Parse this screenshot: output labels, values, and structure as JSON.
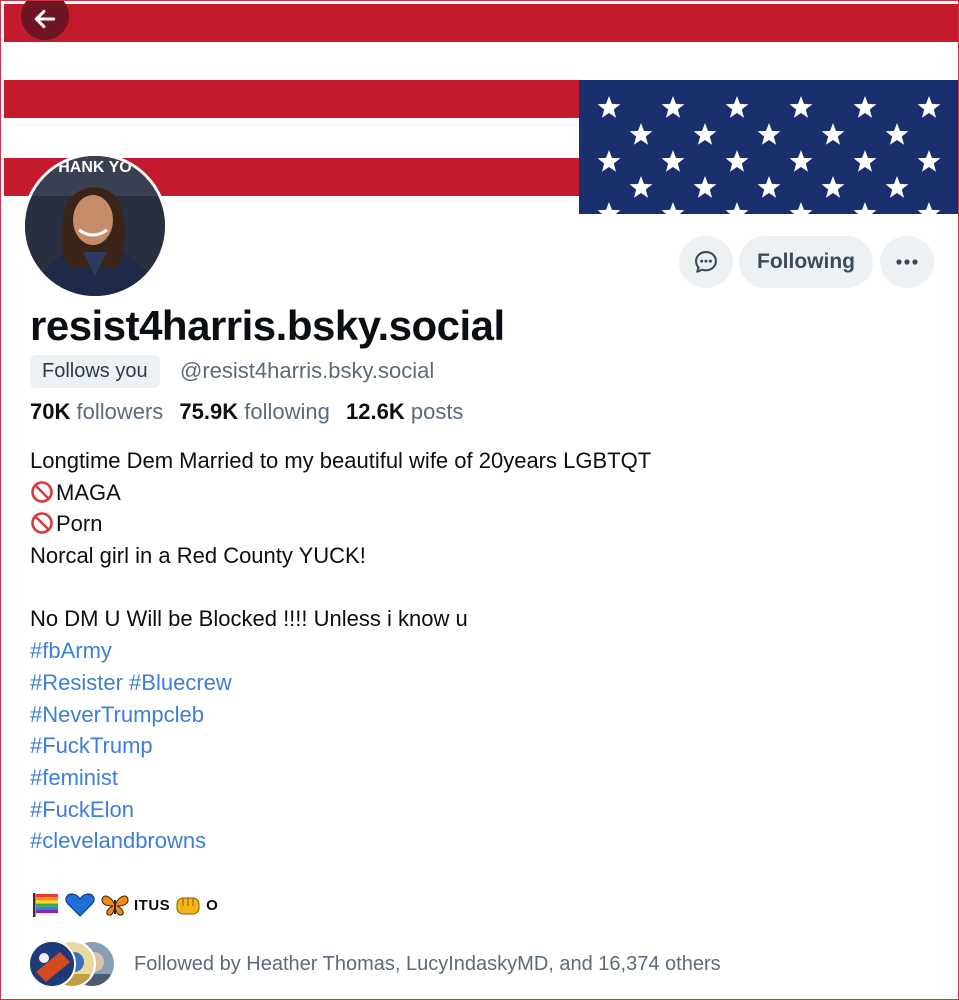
{
  "header": {
    "back_icon": "arrow-left-icon"
  },
  "banner": {
    "description_colors": {
      "red": "#c41a2e",
      "blue": "#1a2f6e",
      "white": "#ffffff"
    },
    "avatar_text": "HANK YO"
  },
  "actions": {
    "message_icon": "chat-bubble-icon",
    "following_label": "Following",
    "more_icon": "ellipsis-icon"
  },
  "profile": {
    "display_name": "resist4harris.bsky.social",
    "follows_you_label": "Follows you",
    "handle": "@resist4harris.bsky.social",
    "stats": {
      "followers_count": "70K",
      "followers_label": "followers",
      "following_count": "75.9K",
      "following_label": "following",
      "posts_count": "12.6K",
      "posts_label": "posts"
    },
    "bio": {
      "line1": "Longtime Dem Married to my beautiful wife of 20years LGBTQT",
      "line2": "MAGA",
      "line3": "Porn",
      "line4": "Norcal girl in a Red County YUCK!",
      "line5": "No DM U Will be Blocked !!!! Unless i know u",
      "hashtags": [
        "#fbArmy",
        "#Resister",
        "#Bluecrew",
        "#NeverTrumpcleb",
        "#FuckTrump",
        "#feminist",
        "#FuckElon",
        "#clevelandbrowns"
      ]
    },
    "emoji_text": "ITUS",
    "emoji_text_end": "O",
    "followed_by": "Followed by Heather Thomas, LucyIndaskyMD, and 16,374 others"
  },
  "accent_color": "#3d7fd6"
}
